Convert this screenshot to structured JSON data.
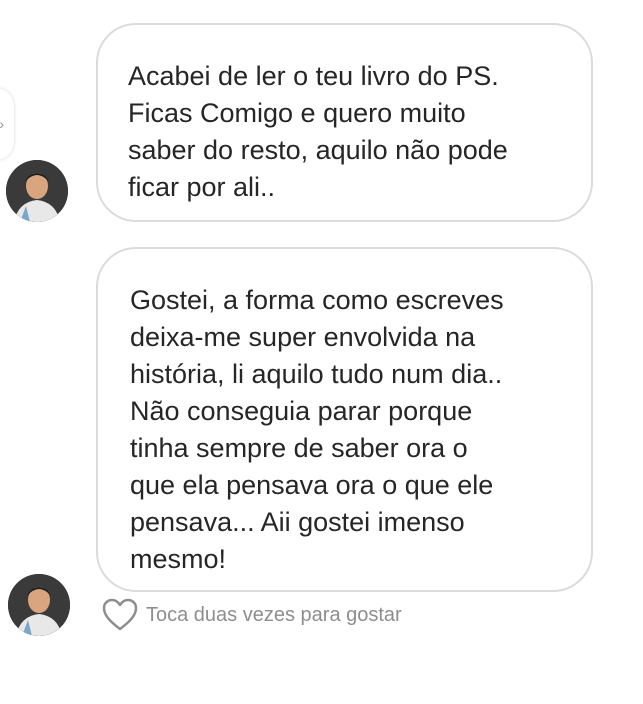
{
  "messages": [
    {
      "text": "Acabei de ler o teu livro do PS.\nFicas Comigo e quero muito\nsaber do resto, aquilo não pode\nficar por ali.."
    },
    {
      "text": "Gostei, a forma como escreves\ndeixa-me super envolvida na\nhistória, li aquilo tudo num dia..\nNão conseguia parar porque\ntinha sempre de saber ora o\nque ela pensava ora o que ele\npensava... Aii gostei imenso\nmesmo!"
    }
  ],
  "like": {
    "hint": "Toca duas vezes para gostar",
    "icon": "heart-outline-icon"
  },
  "colors": {
    "bubble_border": "#dbdbdb",
    "text": "#262626",
    "muted": "#8e8e8e"
  }
}
